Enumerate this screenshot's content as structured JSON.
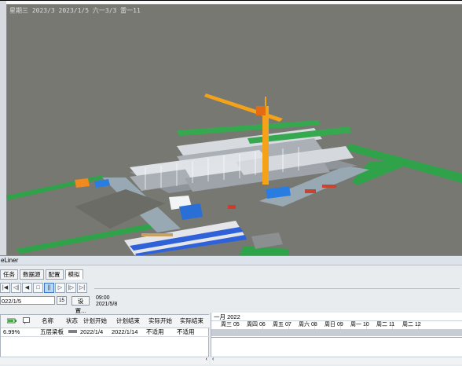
{
  "viewport": {
    "overlay_text": "星期三 2023/3 2023/1/5 六一3/3 雷一11",
    "scene_colors": {
      "ground": "#777872",
      "fence": "#2fa24a",
      "crane": "#f4a21a",
      "building": "#dde1e5",
      "floor": "#9ba0a6"
    }
  },
  "panel": {
    "title": "eLiner",
    "tabs": [
      "任务",
      "数据源",
      "配置",
      "模拟"
    ],
    "active_tab": 3,
    "toolbar_icons": [
      "first-icon",
      "step-back-icon",
      "play-back-icon",
      "stop-icon",
      "pause-icon",
      "play-icon",
      "step-forward-icon",
      "last-icon"
    ],
    "date_value": "022/1/5",
    "calendar_label": "15",
    "settings_label": "设置...",
    "time": "09:00",
    "time_date": "2021/5/8",
    "grid": {
      "headers": [
        "名称",
        "状态",
        "计划开始",
        "计划结束",
        "实际开始",
        "实际结束"
      ],
      "row": {
        "percent": "6.99%",
        "name": "五层梁板",
        "plan_start": "2022/1/4",
        "plan_end": "2022/1/14",
        "actual_start": "不适用",
        "actual_end": "不适用"
      }
    },
    "gantt": {
      "month": "一月 2022",
      "days": [
        "周三 05",
        "周四 06",
        "周五 07",
        "周六 08",
        "周日 09",
        "周一 10",
        "周二 11",
        "周二 12"
      ]
    }
  }
}
